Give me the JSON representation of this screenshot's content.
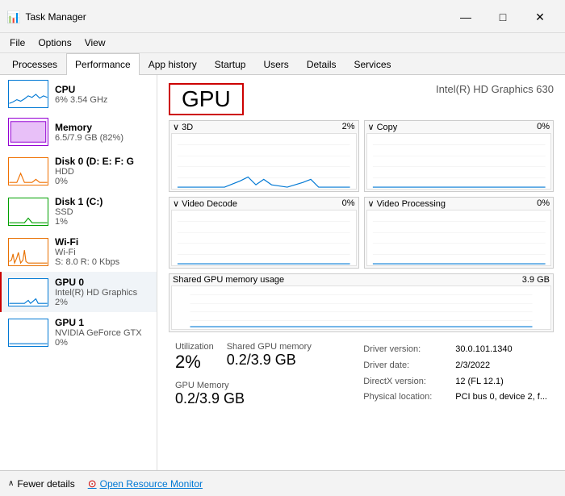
{
  "app": {
    "title": "Task Manager",
    "icon": "📊"
  },
  "titlebar": {
    "minimize": "—",
    "maximize": "□",
    "close": "✕"
  },
  "menu": {
    "items": [
      "File",
      "Options",
      "View"
    ]
  },
  "tabs": [
    {
      "id": "processes",
      "label": "Processes"
    },
    {
      "id": "performance",
      "label": "Performance",
      "active": true
    },
    {
      "id": "app-history",
      "label": "App history"
    },
    {
      "id": "startup",
      "label": "Startup"
    },
    {
      "id": "users",
      "label": "Users"
    },
    {
      "id": "details",
      "label": "Details"
    },
    {
      "id": "services",
      "label": "Services"
    }
  ],
  "sidebar": {
    "items": [
      {
        "id": "cpu",
        "name": "CPU",
        "sub1": "6% 3.54 GHz",
        "color": "#0078d4"
      },
      {
        "id": "memory",
        "name": "Memory",
        "sub1": "6.5/7.9 GB (82%)",
        "color": "#9400d3"
      },
      {
        "id": "disk0",
        "name": "Disk 0 (D: E: F: G",
        "sub1": "HDD",
        "sub2": "0%",
        "color": "#f07000"
      },
      {
        "id": "disk1",
        "name": "Disk 1 (C:)",
        "sub1": "SSD",
        "sub2": "1%",
        "color": "#00a000"
      },
      {
        "id": "wifi",
        "name": "Wi-Fi",
        "sub1": "Wi-Fi",
        "sub2": "S: 8.0 R: 0 Kbps",
        "color": "#e87000"
      },
      {
        "id": "gpu0",
        "name": "GPU 0",
        "sub1": "Intel(R) HD Graphics",
        "sub2": "2%",
        "color": "#0078d4",
        "active": true
      },
      {
        "id": "gpu1",
        "name": "GPU 1",
        "sub1": "NVIDIA GeForce GTX",
        "sub2": "0%",
        "color": "#0078d4"
      }
    ]
  },
  "content": {
    "gpu_title": "GPU",
    "gpu_model": "Intel(R) HD Graphics 630",
    "charts": [
      {
        "id": "3d",
        "label": "3D",
        "pct": "2%",
        "chevron": "∨"
      },
      {
        "id": "copy",
        "label": "Copy",
        "pct": "0%",
        "chevron": "∨"
      },
      {
        "id": "video-decode",
        "label": "Video Decode",
        "pct": "0%",
        "chevron": "∨"
      },
      {
        "id": "video-processing",
        "label": "Video Processing",
        "pct": "0%",
        "chevron": "∨"
      }
    ],
    "shared_mem": {
      "label": "Shared GPU memory usage",
      "value": "3.9 GB"
    },
    "stats": [
      {
        "label": "Utilization",
        "value": "2%"
      },
      {
        "label": "Shared GPU memory",
        "value": "0.2/3.9 GB"
      },
      {
        "label": "GPU Memory",
        "value": "0.2/3.9 GB"
      }
    ],
    "info": {
      "driver_version_label": "Driver version:",
      "driver_version": "30.0.101.1340",
      "driver_date_label": "Driver date:",
      "driver_date": "2/3/2022",
      "directx_label": "DirectX version:",
      "directx": "12 (FL 12.1)",
      "location_label": "Physical location:",
      "location": "PCI bus 0, device 2, f..."
    }
  },
  "bottom": {
    "fewer_details": "Fewer details",
    "open_monitor": "Open Resource Monitor"
  }
}
